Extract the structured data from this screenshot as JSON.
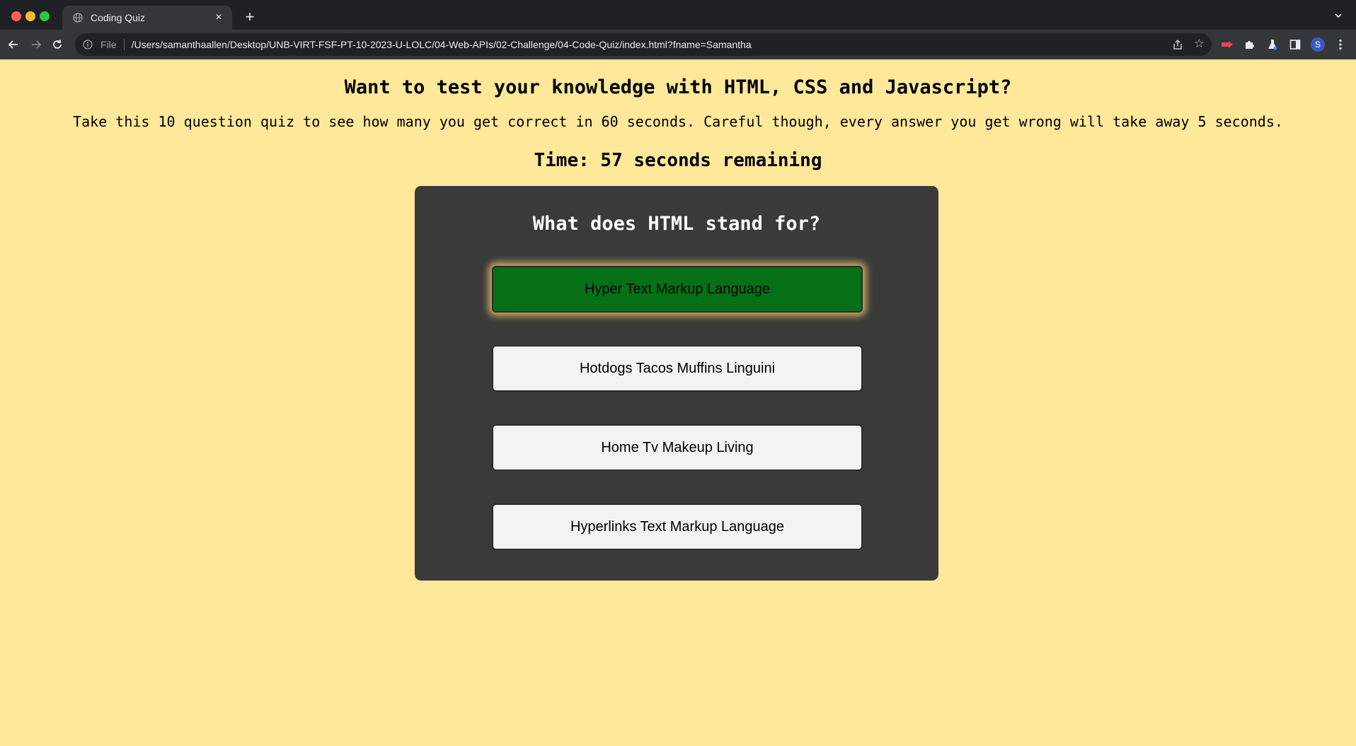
{
  "browser": {
    "tab_title": "Coding Quiz",
    "scheme_label": "File",
    "url": "/Users/samanthaallen/Desktop/UNB-VIRT-FSF-PT-10-2023-U-LOLC/04-Web-APIs/02-Challenge/04-Code-Quiz/index.html?fname=Samantha",
    "profile_initial": "S",
    "icons": [
      "globe-icon",
      "close-icon",
      "plus-icon",
      "chevron-down-icon",
      "back-icon",
      "forward-icon",
      "reload-icon",
      "info-icon",
      "share-icon",
      "star-icon",
      "extension-icon",
      "puzzle-icon",
      "flask-icon",
      "sidebar-icon",
      "kebab-menu-icon"
    ]
  },
  "quiz": {
    "heading": "Want to test your knowledge with HTML, CSS and Javascript?",
    "intro": "Take this 10 question quiz to see how many you get correct in 60 seconds. Careful though, every answer you get wrong will take away 5 seconds.",
    "timer": "Time: 57 seconds remaining",
    "question": "What does HTML stand for?",
    "answers": [
      {
        "label": "Hyper Text Markup Language",
        "state": "correct"
      },
      {
        "label": "Hotdogs Tacos Muffins Linguini",
        "state": "default"
      },
      {
        "label": "Home Tv Makeup Living",
        "state": "default"
      },
      {
        "label": "Hyperlinks Text Markup Language",
        "state": "default"
      }
    ]
  },
  "colors": {
    "page_background": "#ffe89a",
    "card_background": "#3a3a3a",
    "correct_answer": "#057015",
    "answer_default": "#f3f3f3"
  }
}
